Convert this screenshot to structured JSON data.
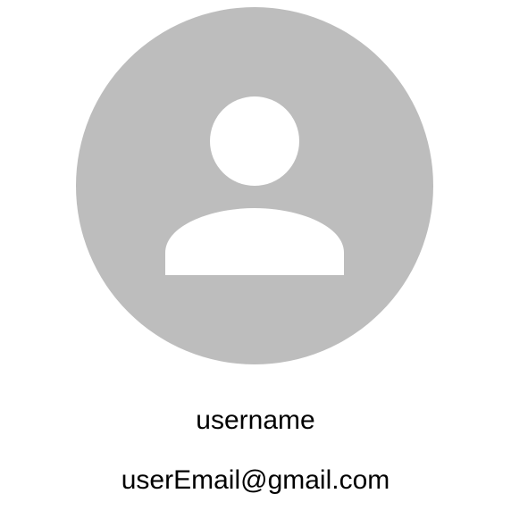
{
  "profile": {
    "avatar_icon": "default-user-avatar-icon",
    "avatar_background_color": "#bdbdbd",
    "avatar_foreground_color": "#ffffff",
    "username": "username",
    "email": "userEmail@gmail.com"
  }
}
